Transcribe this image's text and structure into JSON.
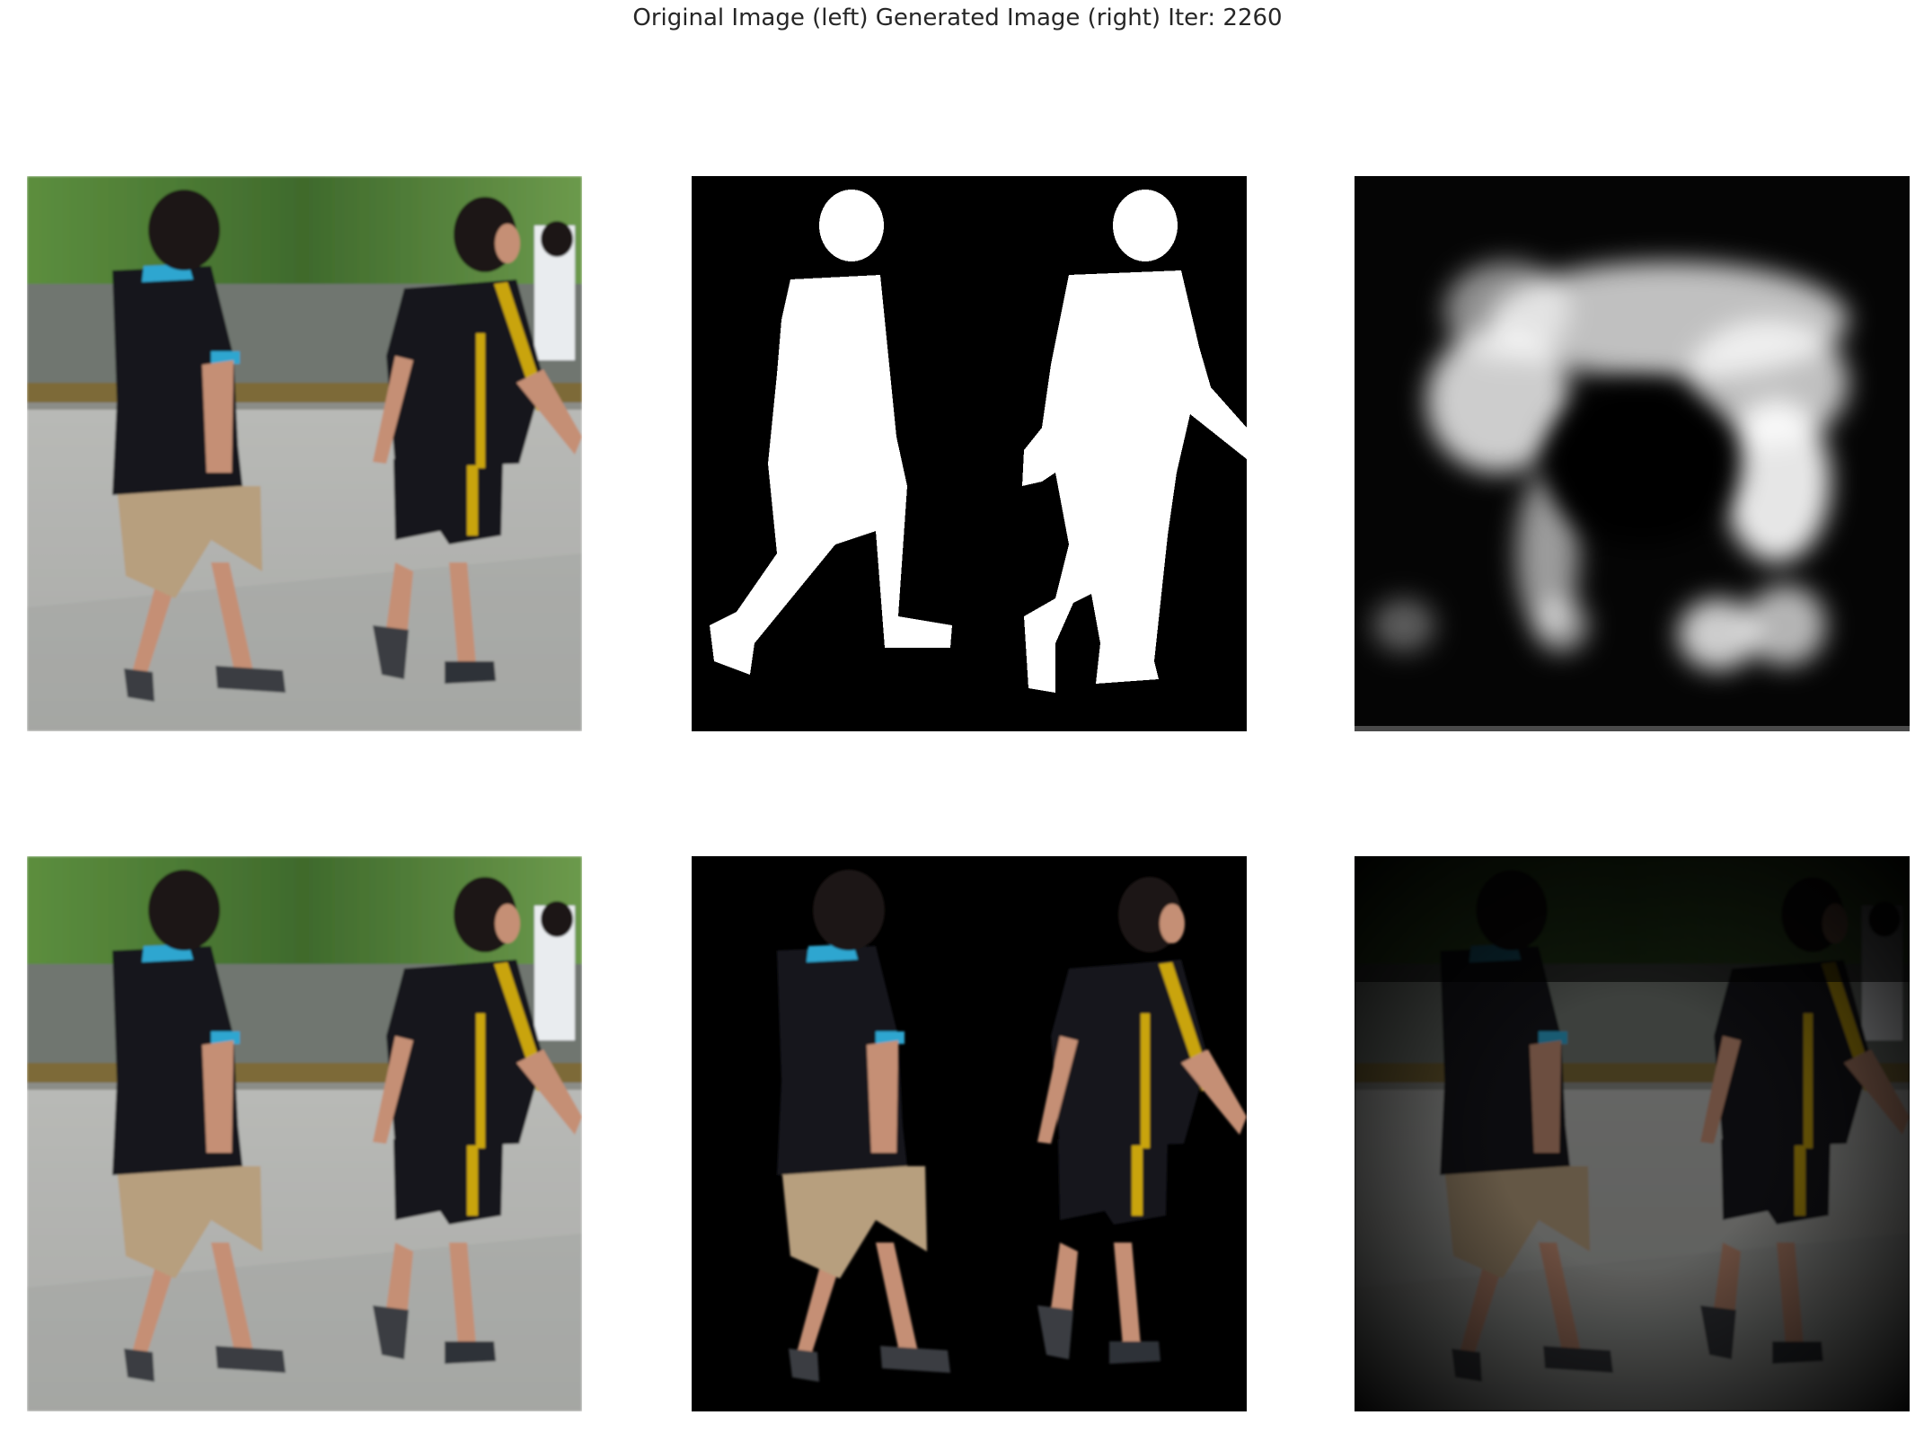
{
  "figure": {
    "title": "Original Image (left) Generated Image (right) Iter: 2260"
  },
  "scene": {
    "subjects": [
      "person-left",
      "person-right"
    ],
    "colors": {
      "road": "#b8b9b6",
      "trees": "#4b7a35",
      "shirt": "#16191f",
      "collar": "#2fa6d0",
      "stripe": "#c9a40e",
      "shorts_left": "#b79f7e",
      "shorts_right": "#15171c",
      "skin": "#c58f74",
      "hair": "#1a1512",
      "mask_fg": "#ffffff",
      "mask_bg": "#000000"
    }
  }
}
